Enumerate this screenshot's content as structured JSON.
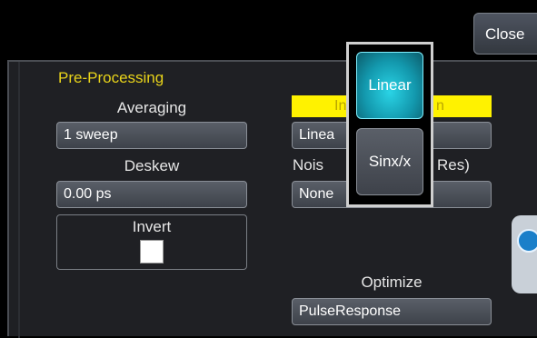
{
  "toolbar": {
    "close_label": "Close"
  },
  "preprocessing": {
    "title": "Pre-Processing",
    "averaging_label": "Averaging",
    "averaging_value": "1 sweep",
    "deskew_label": "Deskew",
    "deskew_value": "0.00 ps",
    "invert_label": "Invert",
    "invert_checked": false
  },
  "interpolation": {
    "header_visible_left": "In",
    "header_visible_right": "n",
    "value_visible": "Linea",
    "noise_label_left": "Nois",
    "noise_label_right": "Res)",
    "noise_value_visible": "None"
  },
  "optimize": {
    "label": "Optimize",
    "value": "PulseResponse"
  },
  "popup": {
    "options": [
      {
        "label": "Linear",
        "selected": true
      },
      {
        "label": "Sinx/x",
        "selected": false
      }
    ]
  },
  "colors": {
    "section_title": "#e8d31a",
    "highlight": "#fff200",
    "selected_option": "#1398ad",
    "panel_bg": "#1f2024"
  },
  "icons": {
    "edge_tab": "help-icon"
  }
}
